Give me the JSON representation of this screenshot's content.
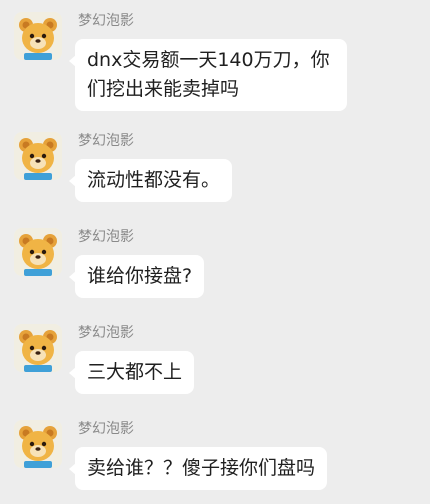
{
  "messages": [
    {
      "sender": "梦幻泡影",
      "text": "dnx交易额一天140万刀，你们挖出来能卖掉吗",
      "avatar_icon": "bear-avatar-icon"
    },
    {
      "sender": "梦幻泡影",
      "text": "流动性都没有。",
      "avatar_icon": "bear-avatar-icon"
    },
    {
      "sender": "梦幻泡影",
      "text": "谁给你接盘?",
      "avatar_icon": "bear-avatar-icon"
    },
    {
      "sender": "梦幻泡影",
      "text": "三大都不上",
      "avatar_icon": "bear-avatar-icon"
    },
    {
      "sender": "梦幻泡影",
      "text": "卖给谁？？傻子接你们盘吗",
      "avatar_icon": "bear-avatar-icon"
    }
  ],
  "colors": {
    "background": "#ededed",
    "bubble": "#ffffff",
    "sender_name": "#8a8a8a",
    "text": "#1f1f1f"
  }
}
